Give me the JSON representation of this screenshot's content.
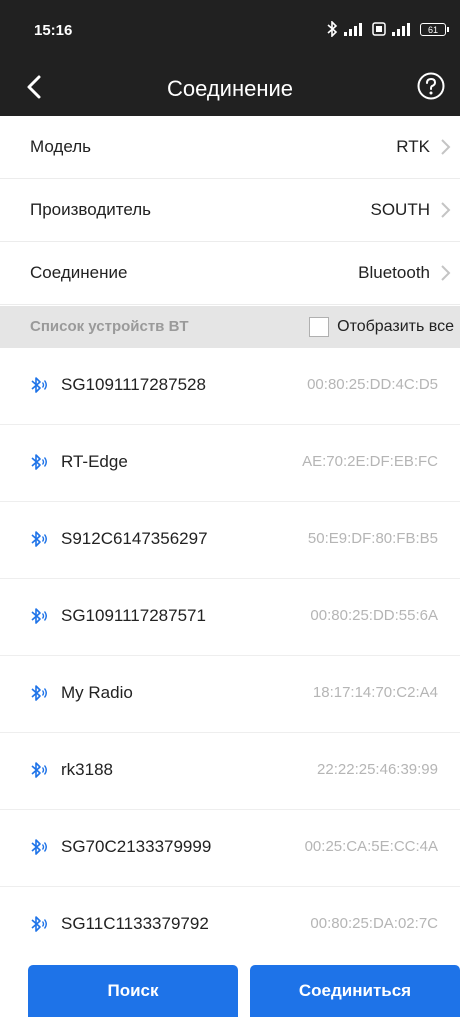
{
  "status_bar": {
    "time": "15:16",
    "battery": "61"
  },
  "header": {
    "title": "Соединение"
  },
  "settings": [
    {
      "label": "Модель",
      "value": "RTK"
    },
    {
      "label": "Производитель",
      "value": "SOUTH"
    },
    {
      "label": "Соединение",
      "value": "Bluetooth"
    }
  ],
  "device_list": {
    "title": "Список устройств BT",
    "show_all_label": "Отобразить все",
    "show_all_checked": false,
    "devices": [
      {
        "name": "SG1091117287528",
        "mac": "00:80:25:DD:4C:D5"
      },
      {
        "name": "RT-Edge",
        "mac": "AE:70:2E:DF:EB:FC"
      },
      {
        "name": "S912C6147356297",
        "mac": "50:E9:DF:80:FB:B5"
      },
      {
        "name": "SG1091117287571",
        "mac": "00:80:25:DD:55:6A"
      },
      {
        "name": "My Radio",
        "mac": "18:17:14:70:C2:A4"
      },
      {
        "name": "rk3188",
        "mac": "22:22:25:46:39:99"
      },
      {
        "name": "SG70C2133379999",
        "mac": "00:25:CA:5E:CC:4A"
      },
      {
        "name": "SG11C1133379792",
        "mac": "00:80:25:DA:02:7C"
      }
    ]
  },
  "buttons": {
    "search": "Поиск",
    "connect": "Соединиться"
  },
  "colors": {
    "accent": "#1e73e8",
    "header_bg": "#212121",
    "bluetooth_icon": "#1e73e8"
  },
  "icons": {
    "back": "chevron-left-icon",
    "help": "help-circle-icon",
    "row_chevron": "chevron-right-icon",
    "device": "bluetooth-icon"
  }
}
